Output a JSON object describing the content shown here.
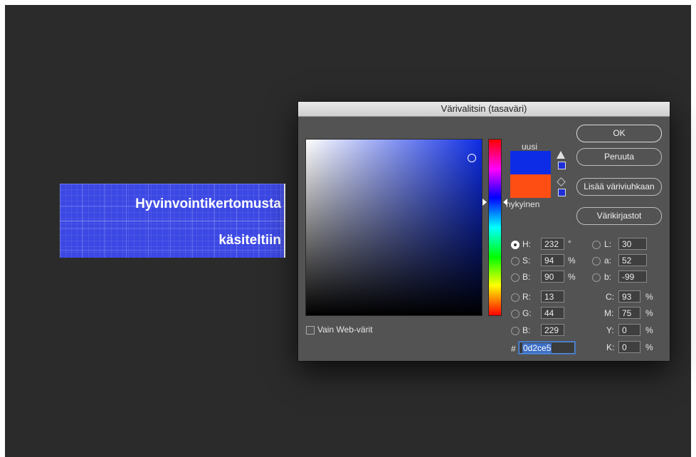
{
  "document": {
    "text_line_1": "Hyvinvointikertomusta",
    "text_line_2": "käsiteltiin"
  },
  "dialog": {
    "title": "Värivalitsin (tasaväri)",
    "new_label": "uusi",
    "current_label": "nykyinen",
    "new_color": "#0d2ce5",
    "current_color": "#fe4e14",
    "buttons": {
      "ok": "OK",
      "cancel": "Peruuta",
      "add_swatch": "Lisää väriviuhkaan",
      "libraries": "Värikirjastot"
    },
    "web_colors_label": "Vain Web-värit",
    "web_colors_checked": false,
    "hsb": {
      "h_label": "H:",
      "h_value": "232",
      "h_unit": "°",
      "s_label": "S:",
      "s_value": "94",
      "s_unit": "%",
      "b_label": "B:",
      "b_value": "90",
      "b_unit": "%"
    },
    "rgb": {
      "r_label": "R:",
      "r_value": "13",
      "g_label": "G:",
      "g_value": "44",
      "b_label": "B:",
      "b_value": "229"
    },
    "lab": {
      "l_label": "L:",
      "l_value": "30",
      "a_label": "a:",
      "a_value": "52",
      "b_label": "b:",
      "b_value": "-99"
    },
    "cmyk": {
      "c_label": "C:",
      "c_value": "93",
      "c_unit": "%",
      "m_label": "M:",
      "m_value": "75",
      "m_unit": "%",
      "y_label": "Y:",
      "y_value": "0",
      "y_unit": "%",
      "k_label": "K:",
      "k_value": "0",
      "k_unit": "%"
    },
    "hex_prefix": "#",
    "hex_value": "0d2ce5",
    "selected_mode": "H"
  }
}
